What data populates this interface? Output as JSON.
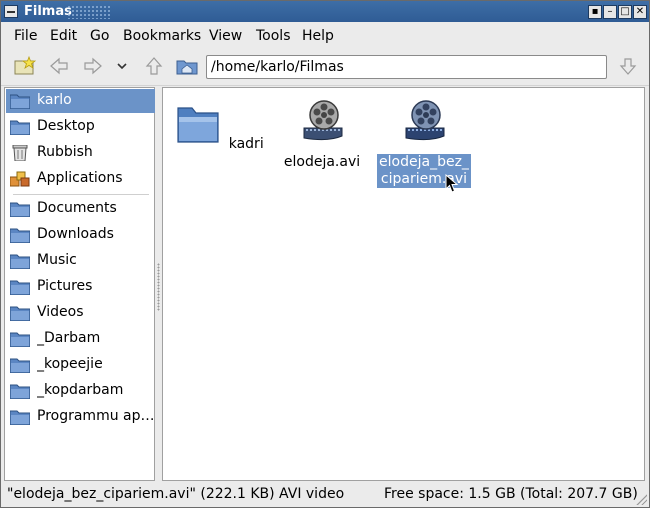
{
  "window": {
    "title": "Filmas"
  },
  "menu": [
    "File",
    "Edit",
    "Go",
    "Bookmarks",
    "View",
    "Tools",
    "Help"
  ],
  "toolbar": {
    "location": "/home/karlo/Filmas"
  },
  "sidebar": {
    "items": [
      {
        "label": "karlo",
        "icon": "home-folder-icon",
        "selected": true
      },
      {
        "label": "Desktop",
        "icon": "folder-icon"
      },
      {
        "label": "Rubbish",
        "icon": "trash-icon"
      },
      {
        "label": "Applications",
        "icon": "applications-icon"
      },
      {
        "label": "Documents",
        "icon": "folder-icon"
      },
      {
        "label": "Downloads",
        "icon": "folder-icon"
      },
      {
        "label": "Music",
        "icon": "folder-icon"
      },
      {
        "label": "Pictures",
        "icon": "folder-icon"
      },
      {
        "label": "Videos",
        "icon": "folder-icon"
      },
      {
        "label": "_Darbam",
        "icon": "folder-icon"
      },
      {
        "label": "_kopeejie",
        "icon": "folder-icon"
      },
      {
        "label": "_kopdarbam",
        "icon": "folder-icon"
      },
      {
        "label": "Programmu ap…",
        "icon": "folder-icon"
      }
    ]
  },
  "files": [
    {
      "name": "kadri",
      "icon": "folder-icon"
    },
    {
      "name": "elodeja.avi",
      "icon": "video-file-icon"
    },
    {
      "name_line1": "elodeja_bez_",
      "name_line2": "cipariem.avi",
      "icon": "video-file-icon",
      "selected": true
    }
  ],
  "status": {
    "selection": "\"elodeja_bez_cipariem.avi\" (222.1 KB) AVI video",
    "free_space": "Free space: 1.5 GB (Total: 207.7 GB)"
  },
  "colors": {
    "titlebar": "#2f5c95",
    "selection": "#6b93c8",
    "folder": "#5b86c3"
  }
}
